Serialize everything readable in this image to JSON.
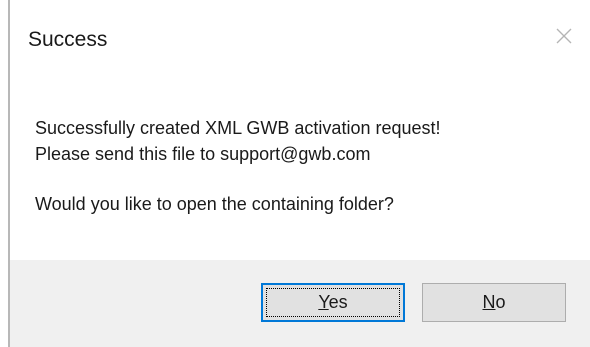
{
  "dialog": {
    "title": "Success",
    "message_line1": "Successfully created XML GWB activation request!",
    "message_line2": "Please send this file to support@gwb.com",
    "question": "Would you like to open the containing folder?"
  },
  "buttons": {
    "yes": {
      "mnemonic": "Y",
      "rest": "es"
    },
    "no": {
      "mnemonic": "N",
      "rest": "o"
    }
  },
  "icons": {
    "close": "close-icon"
  },
  "colors": {
    "focus_border": "#0078d7",
    "footer_bg": "#f0f0f0",
    "button_bg": "#e1e1e1"
  }
}
